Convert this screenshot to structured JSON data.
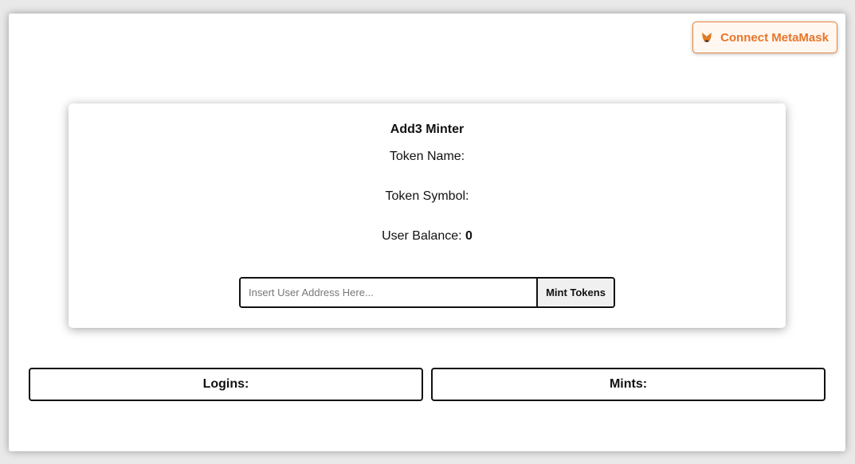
{
  "header": {
    "connect_label": "Connect MetaMask",
    "connect_icon": "metamask-fox-icon",
    "accent_color": "#e8762a"
  },
  "card": {
    "title": "Add3 Minter",
    "token_name_label": "Token Name:",
    "token_name_value": "",
    "token_symbol_label": "Token Symbol:",
    "token_symbol_value": "",
    "user_balance_label": "User Balance:",
    "user_balance_value": "0",
    "address_placeholder": "Insert User Address Here...",
    "address_value": "",
    "mint_label": "Mint Tokens"
  },
  "panels": {
    "logins_label": "Logins:",
    "mints_label": "Mints:"
  }
}
